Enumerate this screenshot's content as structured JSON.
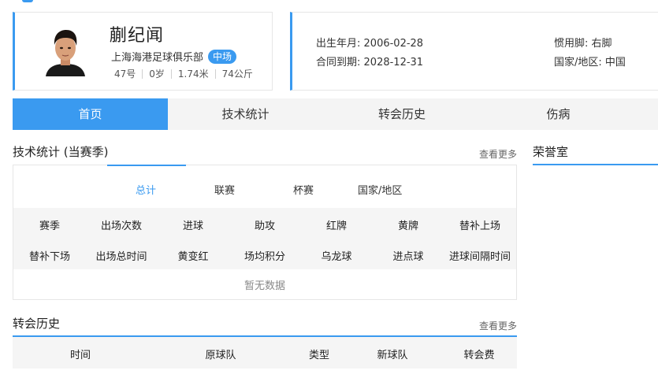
{
  "player": {
    "name": "蒯纪闻",
    "club": "上海海港足球俱乐部",
    "position": "中场",
    "number": "47号",
    "age": "0岁",
    "height": "1.74米",
    "weight": "74公斤"
  },
  "info": {
    "birth_label": "出生年月:",
    "birth_value": "2006-02-28",
    "contract_label": "合同到期:",
    "contract_value": "2028-12-31",
    "foot_label": "惯用脚:",
    "foot_value": "右脚",
    "country_label": "国家/地区:",
    "country_value": "中国"
  },
  "tabs": [
    "首页",
    "技术统计",
    "转会历史",
    "伤病"
  ],
  "stats_section": {
    "title": "技术统计 (当赛季)",
    "more": "查看更多",
    "sub_tabs": [
      "总计",
      "联赛",
      "杯赛",
      "国家/地区"
    ],
    "headers_row1": [
      "赛季",
      "出场次数",
      "进球",
      "助攻",
      "红牌",
      "黄牌",
      "替补上场"
    ],
    "headers_row2": [
      "替补下场",
      "出场总时间",
      "黄变红",
      "场均积分",
      "乌龙球",
      "进点球",
      "进球间隔时间"
    ],
    "empty": "暂无数据"
  },
  "honor_section": {
    "title": "荣誉室"
  },
  "transfer_section": {
    "title": "转会历史",
    "more": "查看更多",
    "columns": [
      "时间",
      "原球队",
      "类型",
      "新球队",
      "转会费"
    ]
  },
  "colors": {
    "accent": "#3a9af0",
    "tab_bg": "#f4f4f4",
    "header_bg": "#f5f5f5"
  }
}
